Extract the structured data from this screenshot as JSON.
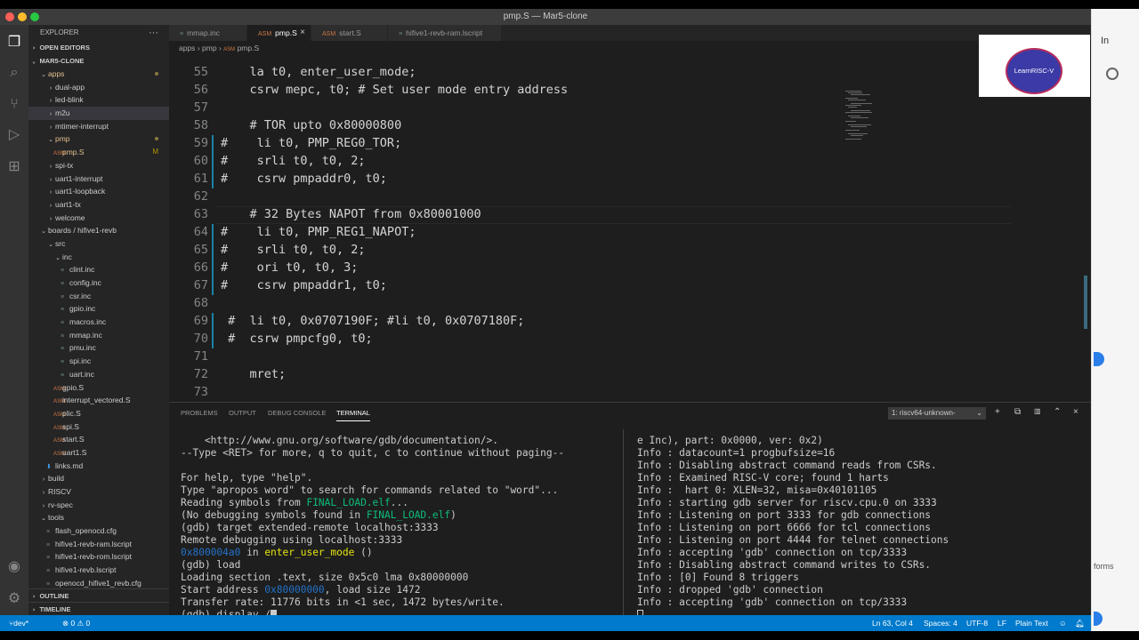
{
  "window": {
    "title": "pmp.S — Mar5-clone"
  },
  "background_window": {
    "fragment_top": "In",
    "fragment_bottom": "forms"
  },
  "sidebar": {
    "header": "EXPLORER",
    "more": "···",
    "open_editors": "OPEN EDITORS",
    "project": "MAR5-CLONE",
    "tree": [
      {
        "label": "apps",
        "indent": 1,
        "chev": "⌄",
        "kind": "folder",
        "dot": true,
        "mod": true
      },
      {
        "label": "dual-app",
        "indent": 2,
        "chev": "›",
        "kind": "folder"
      },
      {
        "label": "led-blink",
        "indent": 2,
        "chev": "›",
        "kind": "folder"
      },
      {
        "label": "m2u",
        "indent": 2,
        "chev": "›",
        "kind": "folder",
        "selected": true
      },
      {
        "label": "mtimer-interrupt",
        "indent": 2,
        "chev": "›",
        "kind": "folder"
      },
      {
        "label": "pmp",
        "indent": 2,
        "chev": "⌄",
        "kind": "folder",
        "dot": true,
        "mod": true
      },
      {
        "label": "pmp.S",
        "indent": 3,
        "kind": "asm",
        "badge": "M",
        "mod": true
      },
      {
        "label": "spi-tx",
        "indent": 2,
        "chev": "›",
        "kind": "folder"
      },
      {
        "label": "uart1-interrupt",
        "indent": 2,
        "chev": "›",
        "kind": "folder"
      },
      {
        "label": "uart1-loopback",
        "indent": 2,
        "chev": "›",
        "kind": "folder"
      },
      {
        "label": "uart1-tx",
        "indent": 2,
        "chev": "›",
        "kind": "folder"
      },
      {
        "label": "welcome",
        "indent": 2,
        "chev": "›",
        "kind": "folder"
      },
      {
        "label": "boards / hifive1-revb",
        "indent": 1,
        "chev": "⌄",
        "kind": "folder"
      },
      {
        "label": "src",
        "indent": 2,
        "chev": "⌄",
        "kind": "folder"
      },
      {
        "label": "inc",
        "indent": 3,
        "chev": "⌄",
        "kind": "folder"
      },
      {
        "label": "clint.inc",
        "indent": 4,
        "kind": "file"
      },
      {
        "label": "config.inc",
        "indent": 4,
        "kind": "file"
      },
      {
        "label": "csr.inc",
        "indent": 4,
        "kind": "file"
      },
      {
        "label": "gpio.inc",
        "indent": 4,
        "kind": "file"
      },
      {
        "label": "macros.inc",
        "indent": 4,
        "kind": "file"
      },
      {
        "label": "mmap.inc",
        "indent": 4,
        "kind": "file"
      },
      {
        "label": "pmu.inc",
        "indent": 4,
        "kind": "file"
      },
      {
        "label": "spi.inc",
        "indent": 4,
        "kind": "file"
      },
      {
        "label": "uart.inc",
        "indent": 4,
        "kind": "file"
      },
      {
        "label": "gpio.S",
        "indent": 3,
        "kind": "asm"
      },
      {
        "label": "interrupt_vectored.S",
        "indent": 3,
        "kind": "asm"
      },
      {
        "label": "plic.S",
        "indent": 3,
        "kind": "asm"
      },
      {
        "label": "spi.S",
        "indent": 3,
        "kind": "asm"
      },
      {
        "label": "start.S",
        "indent": 3,
        "kind": "asm"
      },
      {
        "label": "uart1.S",
        "indent": 3,
        "kind": "asm"
      },
      {
        "label": "links.md",
        "indent": 2,
        "kind": "md"
      },
      {
        "label": "build",
        "indent": 1,
        "chev": "›",
        "kind": "folder"
      },
      {
        "label": "RISCV",
        "indent": 1,
        "chev": "›",
        "kind": "folder"
      },
      {
        "label": "rv-spec",
        "indent": 1,
        "chev": "›",
        "kind": "folder"
      },
      {
        "label": "tools",
        "indent": 1,
        "chev": "⌄",
        "kind": "folder"
      },
      {
        "label": "flash_openocd.cfg",
        "indent": 2,
        "kind": "file"
      },
      {
        "label": "hifive1-revb-ram.lscript",
        "indent": 2,
        "kind": "file"
      },
      {
        "label": "hifive1-revb-rom.lscript",
        "indent": 2,
        "kind": "file"
      },
      {
        "label": "hifive1-revb.lscript",
        "indent": 2,
        "kind": "file"
      },
      {
        "label": "openocd_hifive1_revb.cfg",
        "indent": 2,
        "kind": "file"
      }
    ],
    "outline": "OUTLINE",
    "timeline": "TIMELINE"
  },
  "tabs": [
    {
      "label": "mmap.inc",
      "icon": "≡",
      "active": false
    },
    {
      "label": "pmp.S",
      "icon": "asm",
      "active": true,
      "close": "×"
    },
    {
      "label": "start.S",
      "icon": "asm",
      "active": false
    },
    {
      "label": "hifive1-revb-ram.lscript",
      "icon": "≡",
      "active": false
    }
  ],
  "breadcrumb": {
    "p1": "apps",
    "sep": "›",
    "p2": "pmp",
    "p3": "pmp.S"
  },
  "editor": {
    "lines": [
      {
        "n": "55",
        "text": "    la t0, enter_user_mode;"
      },
      {
        "n": "56",
        "text": "    csrw mepc, t0; # Set user mode entry address"
      },
      {
        "n": "57",
        "text": ""
      },
      {
        "n": "58",
        "text": "    # TOR upto 0x80000800"
      },
      {
        "n": "59",
        "text": "#    li t0, PMP_REG0_TOR;"
      },
      {
        "n": "60",
        "text": "#    srli t0, t0, 2;"
      },
      {
        "n": "61",
        "text": "#    csrw pmpaddr0, t0;"
      },
      {
        "n": "62",
        "text": ""
      },
      {
        "n": "63",
        "text": "    # 32 Bytes NAPOT from 0x80001000"
      },
      {
        "n": "64",
        "text": "#    li t0, PMP_REG1_NAPOT;"
      },
      {
        "n": "65",
        "text": "#    srli t0, t0, 2;"
      },
      {
        "n": "66",
        "text": "#    ori t0, t0, 3;"
      },
      {
        "n": "67",
        "text": "#    csrw pmpaddr1, t0;"
      },
      {
        "n": "68",
        "text": ""
      },
      {
        "n": "69",
        "text": " #  li t0, 0x0707190F; #li t0, 0x0707180F;"
      },
      {
        "n": "70",
        "text": " #  csrw pmpcfg0, t0;"
      },
      {
        "n": "71",
        "text": ""
      },
      {
        "n": "72",
        "text": "    mret;"
      },
      {
        "n": "73",
        "text": ""
      }
    ]
  },
  "overlay": {
    "logo_text": "LearnRISC-V"
  },
  "panel": {
    "tabs": [
      "PROBLEMS",
      "OUTPUT",
      "DEBUG CONSOLE",
      "TERMINAL"
    ],
    "active_tab": "TERMINAL",
    "terminal_select": "1: riscv64-unknown-",
    "icons": {
      "add": "+",
      "split": "⧉",
      "trash": "🗑",
      "max": "⌃",
      "close": "×"
    },
    "left_terminal": [
      [
        {
          "t": "    <http://www.gnu.org/software/gdb/documentation/>."
        }
      ],
      [
        {
          "t": "--Type <RET> for more, q to quit, c to continue without paging--"
        }
      ],
      [
        {
          "t": ""
        }
      ],
      [
        {
          "t": "For help, type \"help\"."
        }
      ],
      [
        {
          "t": "Type \"apropos word\" to search for commands related to \"word\"..."
        }
      ],
      [
        {
          "t": "Reading symbols from "
        },
        {
          "t": "FINAL_LOAD.elf",
          "c": "green"
        },
        {
          "t": "..."
        }
      ],
      [
        {
          "t": "(No debugging symbols found in "
        },
        {
          "t": "FINAL_LOAD.elf",
          "c": "green"
        },
        {
          "t": ")"
        }
      ],
      [
        {
          "t": "(gdb) target extended-remote localhost:3333"
        }
      ],
      [
        {
          "t": "Remote debugging using localhost:3333"
        }
      ],
      [
        {
          "t": "0x800004a0",
          "c": "blue"
        },
        {
          "t": " in "
        },
        {
          "t": "enter_user_mode",
          "c": "yellow"
        },
        {
          "t": " ()"
        }
      ],
      [
        {
          "t": "(gdb) load"
        }
      ],
      [
        {
          "t": "Loading section .text, size 0x5c0 lma 0x80000000"
        }
      ],
      [
        {
          "t": "Start address "
        },
        {
          "t": "0x80000000",
          "c": "blue"
        },
        {
          "t": ", load size 1472"
        }
      ],
      [
        {
          "t": "Transfer rate: 11776 bits in <1 sec, 1472 bytes/write."
        }
      ],
      [
        {
          "t": "(gdb) display /"
        }
      ]
    ],
    "right_terminal": [
      "e Inc), part: 0x0000, ver: 0x2)",
      "Info : datacount=1 progbufsize=16",
      "Info : Disabling abstract command reads from CSRs.",
      "Info : Examined RISC-V core; found 1 harts",
      "Info :  hart 0: XLEN=32, misa=0x40101105",
      "Info : starting gdb server for riscv.cpu.0 on 3333",
      "Info : Listening on port 3333 for gdb connections",
      "Info : Listening on port 6666 for tcl connections",
      "Info : Listening on port 4444 for telnet connections",
      "Info : accepting 'gdb' connection on tcp/3333",
      "Info : Disabling abstract command writes to CSRs.",
      "Info : [0] Found 8 triggers",
      "Info : dropped 'gdb' connection",
      "Info : accepting 'gdb' connection on tcp/3333",
      ""
    ]
  },
  "status": {
    "branch": "dev*",
    "problems": "⊗ 0 ⚠ 0",
    "position": "Ln 63, Col 4",
    "spaces": "Spaces: 4",
    "encoding": "UTF-8",
    "eol": "LF",
    "language": "Plain Text"
  }
}
